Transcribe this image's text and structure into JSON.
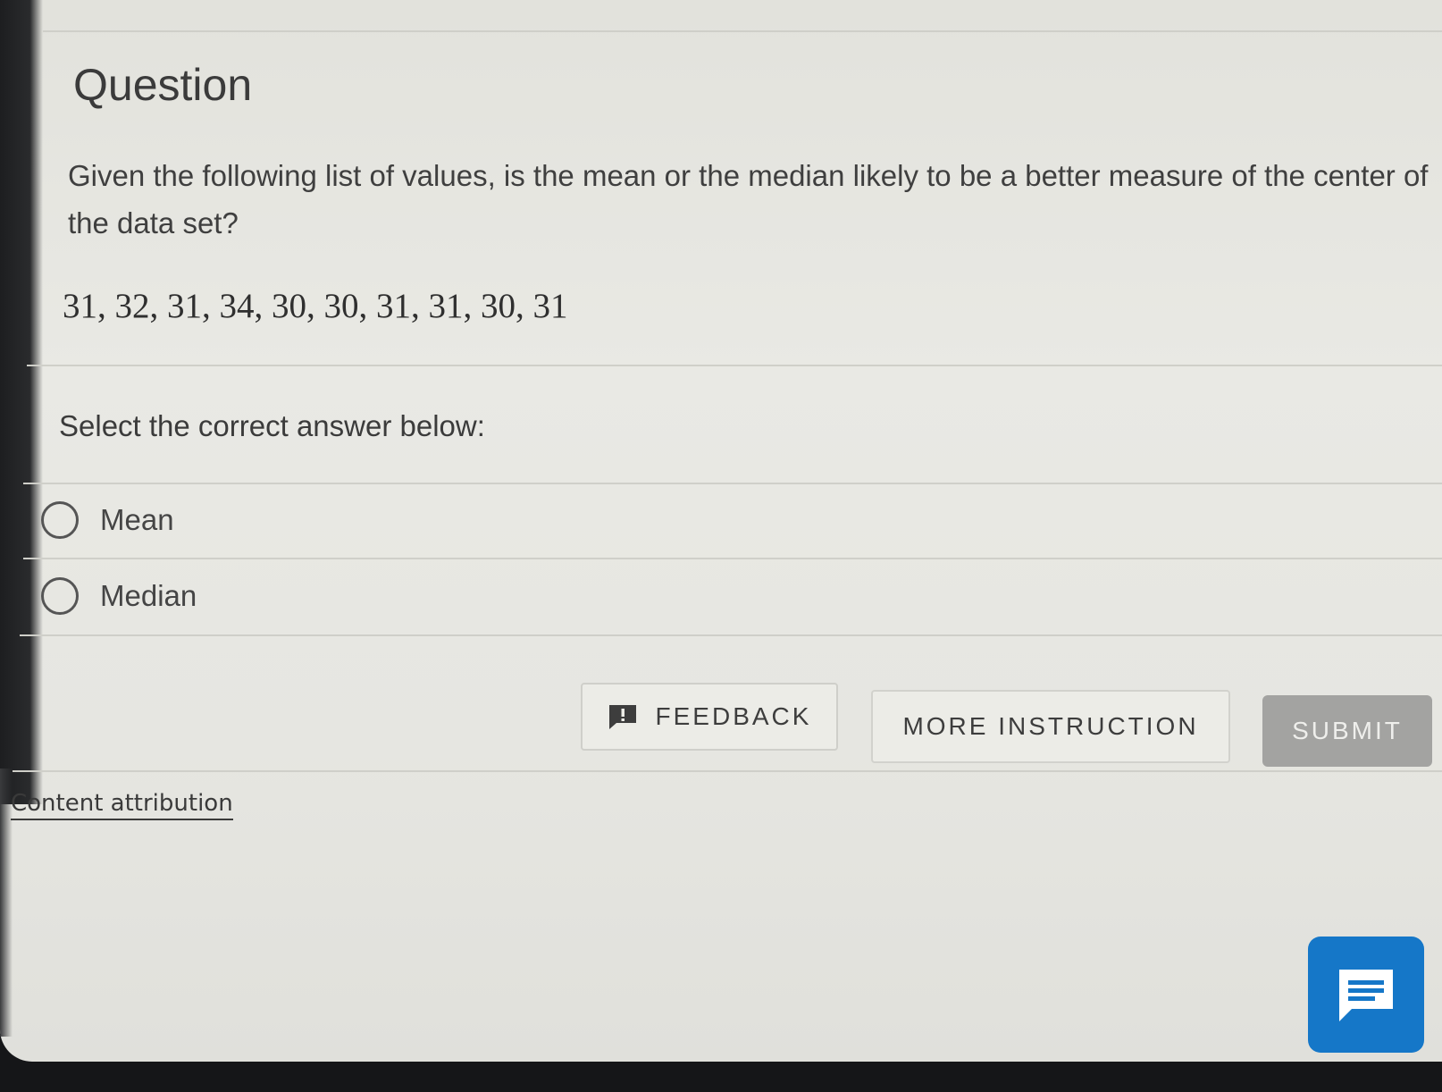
{
  "question": {
    "title": "Question",
    "text": "Given the following list of values, is the mean or the median likely to be a better measure of the center of the data set?",
    "values": "31, 32, 31, 34, 30, 30, 31, 31, 30, 31"
  },
  "answer": {
    "prompt": "Select the correct answer below:",
    "options": [
      {
        "label": "Mean",
        "selected": false
      },
      {
        "label": "Median",
        "selected": false
      }
    ]
  },
  "buttons": {
    "feedback": "FEEDBACK",
    "more_instruction": "MORE INSTRUCTION",
    "submit": "SUBMIT"
  },
  "footer": {
    "attribution": "Content attribution"
  },
  "icons": {
    "feedback": "feedback-flag-icon",
    "chat": "chat-icon"
  },
  "colors": {
    "chat_button": "#1577c8",
    "submit_disabled": "#a3a3a1"
  }
}
